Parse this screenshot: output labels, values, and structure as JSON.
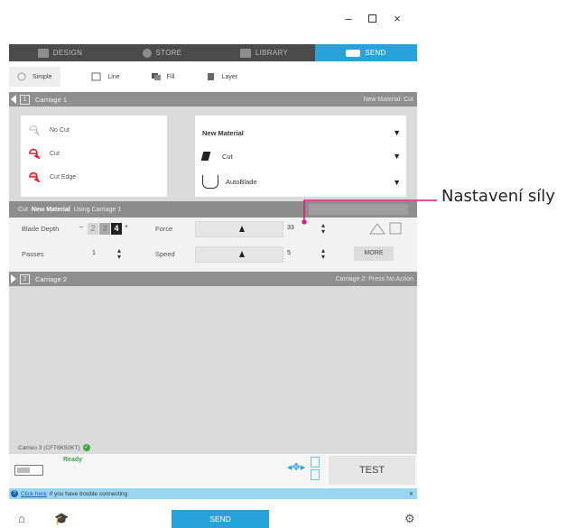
{
  "window": {
    "minimize": "–",
    "maximize": "□",
    "close": "×"
  },
  "main_tabs": [
    {
      "label": "DESIGN",
      "active": false
    },
    {
      "label": "STORE",
      "active": false
    },
    {
      "label": "LIBRARY",
      "active": false
    },
    {
      "label": "SEND",
      "active": true
    }
  ],
  "modes": [
    "Simple",
    "Line",
    "Fill",
    "Layer"
  ],
  "carriage1": {
    "label": "Carriage 1",
    "num": "1",
    "material_status": "New Material: Cut"
  },
  "cut_options": [
    "No Cut",
    "Cut",
    "Cut Edge"
  ],
  "dropdowns": [
    {
      "label": "New Material"
    },
    {
      "label": "Cut"
    },
    {
      "label": "AutoBlade"
    }
  ],
  "info_bar": {
    "prefix": "Cut",
    "material": "New Material",
    "suffix": "Using Carriage 1"
  },
  "settings": {
    "blade_depth_label": "Blade Depth",
    "blade_depth_minus": "–",
    "blade_depth_plus": "+",
    "blade_depth_values": [
      "2",
      "3",
      "4"
    ],
    "passes_label": "Passes",
    "passes_value": "1",
    "force_label": "Force",
    "force_value": "33",
    "speed_label": "Speed",
    "speed_value": "5",
    "more_label": "MORE"
  },
  "carriage2": {
    "label": "Carriage 2",
    "num": "2",
    "status": "Carriage 2: Press No Action"
  },
  "device_status": "Cameo 3 (CFT6K50KT)",
  "ready_label": "Ready",
  "test_label": "TEST",
  "help": {
    "link": "Click here",
    "text": "if you have trouble connecting"
  },
  "send_label": "SEND",
  "callout": {
    "text": "Nastavení síly"
  },
  "colors": {
    "accent": "#28a3d9",
    "callout": "#e0177e"
  }
}
